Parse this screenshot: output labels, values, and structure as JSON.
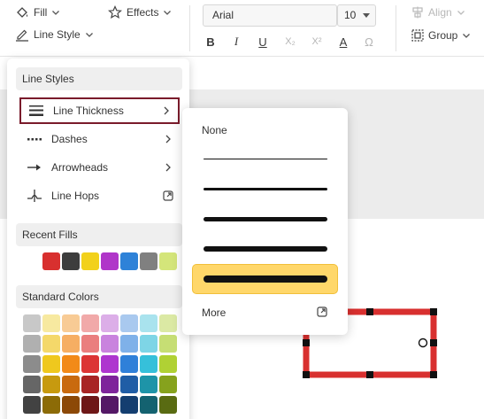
{
  "toolbar": {
    "fill_label": "Fill",
    "effects_label": "Effects",
    "line_style_label": "Line Style",
    "font_value": "Arial",
    "font_size_value": "10",
    "align_label": "Align",
    "group_label": "Group",
    "bold_glyph": "B",
    "italic_glyph": "I",
    "underline_glyph": "U",
    "subscript_glyph": "X₂",
    "superscript_glyph": "X²",
    "text_color_glyph": "A",
    "special_char_glyph": "Ω"
  },
  "line_styles_menu": {
    "header": "Line Styles",
    "items": [
      {
        "label": "Line Thickness",
        "icon": "line-thickness-icon"
      },
      {
        "label": "Dashes",
        "icon": "dashes-icon"
      },
      {
        "label": "Arrowheads",
        "icon": "arrowhead-icon"
      },
      {
        "label": "Line Hops",
        "icon": "line-hops-icon"
      }
    ],
    "recent_fills_header": "Recent Fills",
    "recent_fills": [
      "#d8302f",
      "#3d3d3d",
      "#f2d11b",
      "#b036c9",
      "#2e82d8",
      "#808080",
      "#d4e57a"
    ],
    "standard_colors_header": "Standard Colors",
    "standard_colors": [
      [
        "#c8c8c8",
        "#f7e9a0",
        "#f8cb95",
        "#f1a9a9",
        "#dcaee8",
        "#a9c9ef",
        "#a9e3ee",
        "#dbe9a4"
      ],
      [
        "#b0b0b0",
        "#f4d86a",
        "#f6ae63",
        "#ea7e7e",
        "#c983de",
        "#7fb1e9",
        "#7ed5e6",
        "#c6de74"
      ],
      [
        "#8c8c8c",
        "#efc81e",
        "#f28a18",
        "#dc3535",
        "#ae36cf",
        "#2f80d9",
        "#36c0da",
        "#b0d134"
      ],
      [
        "#666666",
        "#c79a0f",
        "#c96a0e",
        "#a82424",
        "#7e249b",
        "#1f5da6",
        "#1e94a8",
        "#86a21d"
      ],
      [
        "#424242",
        "#8c6b07",
        "#8c4907",
        "#6e1717",
        "#541866",
        "#143e70",
        "#146270",
        "#596b12"
      ]
    ]
  },
  "thickness_submenu": {
    "none_label": "None",
    "options": [
      {
        "weight": 1,
        "selected": false
      },
      {
        "weight": 3,
        "selected": false
      },
      {
        "weight": 5,
        "selected": false
      },
      {
        "weight": 6,
        "selected": false
      },
      {
        "weight": 8,
        "selected": true
      }
    ],
    "more_label": "More"
  },
  "colors": {
    "menu_highlight_border": "#7a1b2b",
    "selected_option_bg": "#ffd76a",
    "shape_stroke": "#d8302f"
  }
}
